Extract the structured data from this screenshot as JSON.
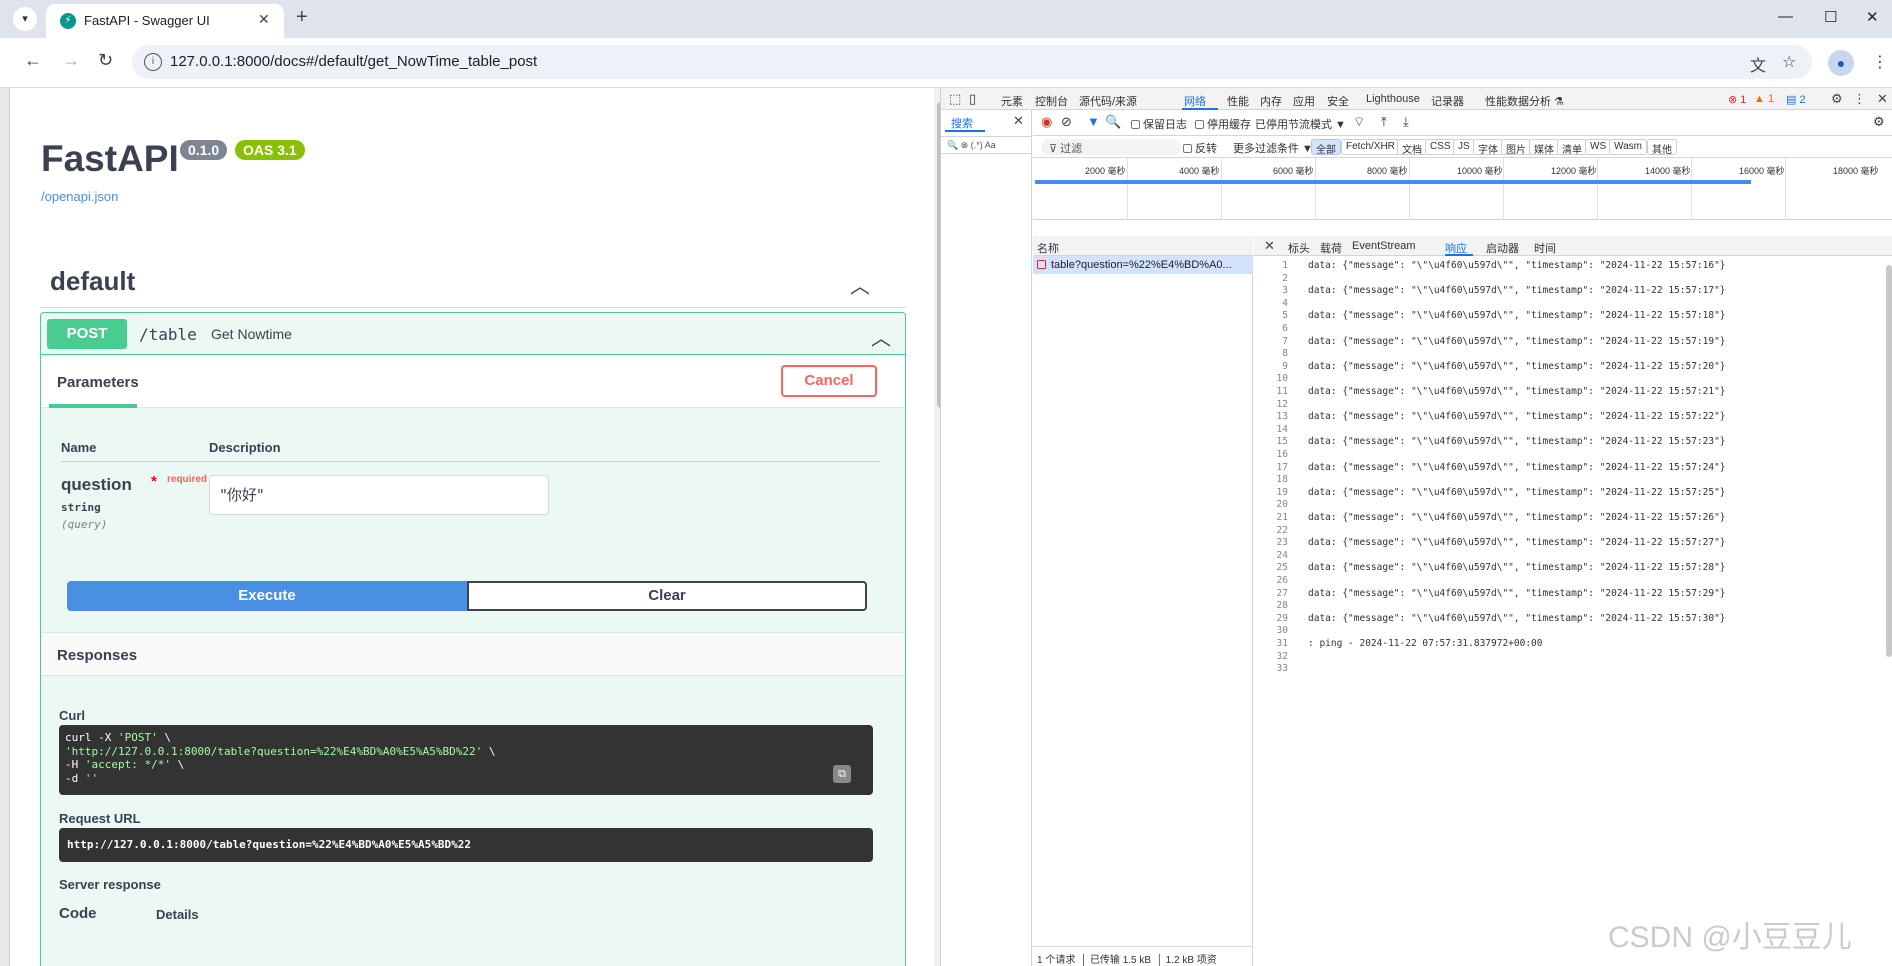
{
  "browser": {
    "tab_title": "FastAPI - Swagger UI",
    "url": "127.0.0.1:8000/docs#/default/get_NowTime_table_post"
  },
  "swagger": {
    "title": "FastAPI",
    "version": "0.1.0",
    "oas": "OAS 3.1",
    "openapi_link": "/openapi.json",
    "tag": "default",
    "operation": {
      "method": "POST",
      "path": "/table",
      "summary": "Get Nowtime"
    },
    "parameters_tab": "Parameters",
    "cancel_label": "Cancel",
    "col_name": "Name",
    "col_description": "Description",
    "param": {
      "name": "question",
      "required_star": "*",
      "required_label": "required",
      "type": "string",
      "in": "(query)",
      "value": "\"你好\""
    },
    "execute_label": "Execute",
    "clear_label": "Clear",
    "responses_title": "Responses",
    "curl_label": "Curl",
    "curl": {
      "l1a": "curl -X ",
      "l1b": "'POST'",
      "l1c": " \\",
      "l2a": "  ",
      "l2b": "'http://127.0.0.1:8000/table?question=%22%E4%BD%A0%E5%A5%BD%22'",
      "l2c": " \\",
      "l3a": "  -H ",
      "l3b": "'accept: */*'",
      "l3c": " \\",
      "l4a": "  -d ",
      "l4b": "''"
    },
    "request_url_label": "Request URL",
    "request_url": "http://127.0.0.1:8000/table?question=%22%E4%BD%A0%E5%A5%BD%22",
    "server_response_label": "Server response",
    "code_col": "Code",
    "details_col": "Details"
  },
  "devtools": {
    "tabs": [
      "元素",
      "控制台",
      "源代码/来源",
      "网络",
      "性能",
      "内存",
      "应用",
      "安全",
      "Lighthouse",
      "记录器",
      "性能数据分析 ⚗"
    ],
    "errors": "1",
    "warnings": "1",
    "messages": "2",
    "search_tab": "搜索",
    "search_options": "(.*) Aa",
    "toolbar": {
      "preserve_log": "保留日志",
      "disable_cache": "停用缓存",
      "throttle": "已停用节流模式"
    },
    "filter_placeholder": "过滤",
    "invert": "反转",
    "more_filters": "更多过滤条件",
    "filter_types": [
      "全部",
      "Fetch/XHR",
      "文档",
      "CSS",
      "JS",
      "字体",
      "图片",
      "媒体",
      "清单",
      "WS",
      "Wasm",
      "其他"
    ],
    "timeline_ticks": [
      "2000 毫秒",
      "4000 毫秒",
      "6000 毫秒",
      "8000 毫秒",
      "10000 毫秒",
      "12000 毫秒",
      "14000 毫秒",
      "16000 毫秒",
      "18000 毫秒"
    ],
    "name_col": "名称",
    "request_name": "table?question=%22%E4%BD%A0...",
    "detail_tabs": [
      "标头",
      "载荷",
      "EventStream",
      "响应",
      "启动器",
      "时间"
    ],
    "response_lines": [
      "data: {\"message\": \"\\\"\\u4f60\\u597d\\\"\", \"timestamp\": \"2024-11-22 15:57:16\"}",
      "",
      "data: {\"message\": \"\\\"\\u4f60\\u597d\\\"\", \"timestamp\": \"2024-11-22 15:57:17\"}",
      "",
      "data: {\"message\": \"\\\"\\u4f60\\u597d\\\"\", \"timestamp\": \"2024-11-22 15:57:18\"}",
      "",
      "data: {\"message\": \"\\\"\\u4f60\\u597d\\\"\", \"timestamp\": \"2024-11-22 15:57:19\"}",
      "",
      "data: {\"message\": \"\\\"\\u4f60\\u597d\\\"\", \"timestamp\": \"2024-11-22 15:57:20\"}",
      "",
      "data: {\"message\": \"\\\"\\u4f60\\u597d\\\"\", \"timestamp\": \"2024-11-22 15:57:21\"}",
      "",
      "data: {\"message\": \"\\\"\\u4f60\\u597d\\\"\", \"timestamp\": \"2024-11-22 15:57:22\"}",
      "",
      "data: {\"message\": \"\\\"\\u4f60\\u597d\\\"\", \"timestamp\": \"2024-11-22 15:57:23\"}",
      "",
      "data: {\"message\": \"\\\"\\u4f60\\u597d\\\"\", \"timestamp\": \"2024-11-22 15:57:24\"}",
      "",
      "data: {\"message\": \"\\\"\\u4f60\\u597d\\\"\", \"timestamp\": \"2024-11-22 15:57:25\"}",
      "",
      "data: {\"message\": \"\\\"\\u4f60\\u597d\\\"\", \"timestamp\": \"2024-11-22 15:57:26\"}",
      "",
      "data: {\"message\": \"\\\"\\u4f60\\u597d\\\"\", \"timestamp\": \"2024-11-22 15:57:27\"}",
      "",
      "data: {\"message\": \"\\\"\\u4f60\\u597d\\\"\", \"timestamp\": \"2024-11-22 15:57:28\"}",
      "",
      "data: {\"message\": \"\\\"\\u4f60\\u597d\\\"\", \"timestamp\": \"2024-11-22 15:57:29\"}",
      "",
      "data: {\"message\": \"\\\"\\u4f60\\u597d\\\"\", \"timestamp\": \"2024-11-22 15:57:30\"}",
      "",
      ": ping - 2024-11-22 07:57:31.837972+00:00",
      "",
      ""
    ],
    "footer": {
      "requests": "1 个请求",
      "transferred": "已传输 1.5 kB",
      "resources": "1.2 kB 项资"
    }
  },
  "watermark": "CSDN @小豆豆儿"
}
